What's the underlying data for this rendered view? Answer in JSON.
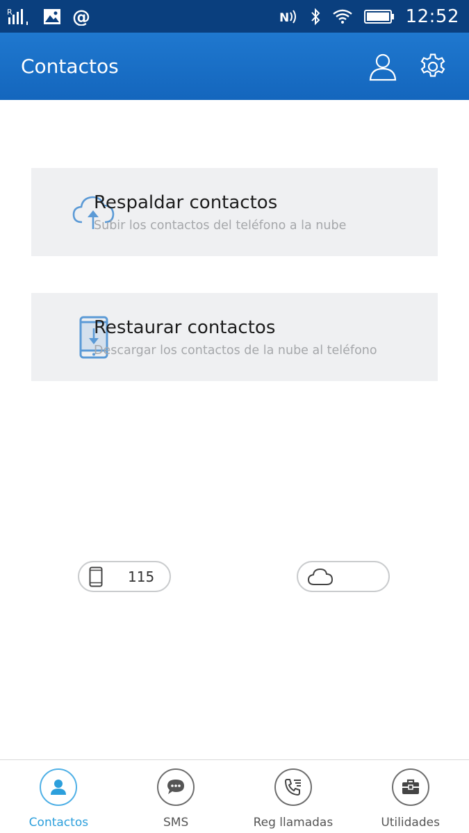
{
  "status_bar": {
    "time": "12:52",
    "icons": [
      "signal-icon",
      "image-notification-icon",
      "at-icon",
      "nfc-icon",
      "bluetooth-icon",
      "wifi-icon",
      "battery-icon"
    ]
  },
  "app_bar": {
    "title": "Contactos",
    "actions": [
      "account-icon",
      "settings-gear-icon"
    ]
  },
  "cards": [
    {
      "icon": "cloud-upload-icon",
      "title": "Respaldar contactos",
      "subtitle": "Subir los contactos del teléfono a la nube"
    },
    {
      "icon": "phone-download-icon",
      "title": "Restaurar contactos",
      "subtitle": "Descargar los contactos de la nube al teléfono"
    }
  ],
  "counts": {
    "phone": {
      "icon": "phone-icon",
      "value": "115"
    },
    "cloud": {
      "icon": "cloud-icon",
      "value": ""
    }
  },
  "bottom_nav": {
    "items": [
      {
        "label": "Contactos",
        "icon": "person-icon",
        "active": true
      },
      {
        "label": "SMS",
        "icon": "chat-icon",
        "active": false
      },
      {
        "label": "Reg llamadas",
        "icon": "call-log-icon",
        "active": false
      },
      {
        "label": "Utilidades",
        "icon": "briefcase-icon",
        "active": false
      }
    ]
  },
  "colors": {
    "status_bar": "#0a3f7e",
    "app_bar": "#1466bd",
    "card_bg": "#eff0f2",
    "accent": "#2c9fdc",
    "card_icon": "#5b9ad6"
  }
}
